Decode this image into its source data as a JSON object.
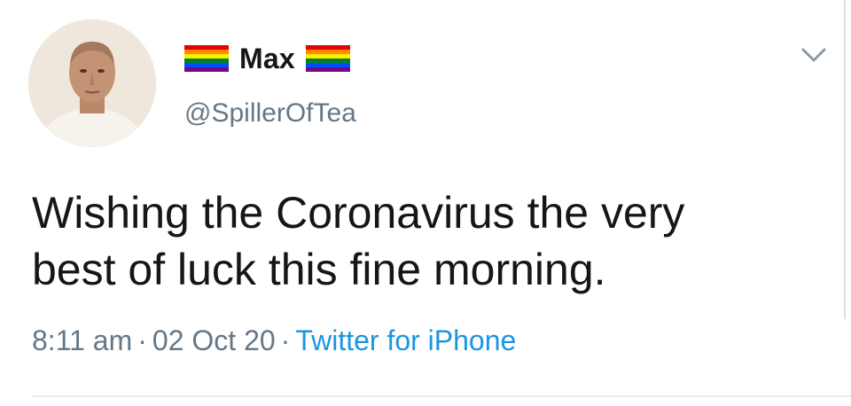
{
  "tweet": {
    "user": {
      "display_name": "Max",
      "handle": "@SpillerOfTea",
      "name_prefix_emoji": "rainbow-flag",
      "name_suffix_emoji": "rainbow-flag",
      "avatar": "profile-photo"
    },
    "text_line1": "Wishing the Coronavirus the very",
    "text_line2": "best of luck this fine morning.",
    "time": "8:11 am",
    "separator": "·",
    "date": "02 Oct 20",
    "source": "Twitter for iPhone",
    "menu_icon": "chevron-down-icon"
  },
  "colors": {
    "text_primary": "#14171a",
    "text_secondary": "#657786",
    "link": "#1b95e0",
    "divider": "#e6ecf0"
  }
}
